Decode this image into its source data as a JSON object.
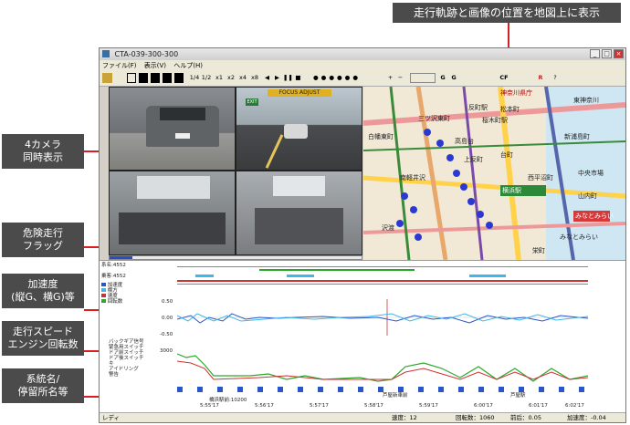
{
  "callouts": {
    "map": "走行軌跡と画像の位置を地図上に表示",
    "camera": [
      "4カメラ",
      "同時表示"
    ],
    "danger": [
      "危険走行",
      "フラッグ"
    ],
    "accel": [
      "加速度",
      "(縦G、横G)等"
    ],
    "speed": [
      "走行スピード",
      "エンジン回転数"
    ],
    "route": [
      "系統名/",
      "停留所名等"
    ]
  },
  "window": {
    "title": "CTA-039-300-300",
    "menu": [
      "ファイル(F)",
      "表示(V)",
      "ヘルプ(H)"
    ],
    "toolbar_speed": [
      "1/4",
      "1/2",
      "x1",
      "x2",
      "x4",
      "x8"
    ],
    "toolbar_misc": [
      "+",
      "−",
      "G",
      "G",
      "CF",
      "R"
    ]
  },
  "camera": {
    "overlay": "FOCUS ADJUST",
    "exit_sign": "EXIT"
  },
  "map_labels": [
    "神奈川県庁",
    "三ツ沢東町",
    "桜木町駅",
    "東神奈川",
    "台町",
    "西平沼町",
    "南軽井沢",
    "高島台",
    "横浜駅",
    "みなとみらい",
    "みなとみらい",
    "上反町",
    "新浦島町",
    "沢渡",
    "中央市場",
    "山内町",
    "白幡東町",
    "松本町",
    "反町駅",
    "栄町"
  ],
  "panel": {
    "row1_label": "系名:4552",
    "row2_label": "乗客:4552",
    "legend1": [
      "加速度",
      "横方",
      "速度",
      "回転数"
    ],
    "legend2": [
      "バックギア信号",
      "緊急用スイッチ",
      "ドア前スイッチ",
      "ドア後スイッチ",
      "キ",
      "アイドリング",
      "警告"
    ],
    "y_top": [
      "0.50",
      "0.00",
      "-0.50"
    ],
    "y_bottom": [
      "3000"
    ],
    "stop_labels": [
      "橋浜駅前:10200",
      "芦屋新車前",
      "芦屋駅"
    ],
    "time_ticks": [
      "5:55'17",
      "5:56'17",
      "5:57'17",
      "5:58'17",
      "5:59'17",
      "6:00'17",
      "6:01'17",
      "6:02'17"
    ]
  },
  "status": {
    "ready": "レディ",
    "speed": "速度：12",
    "rpm": "回転数：1060",
    "brake": "前后：0.05",
    "accel": "加速度：-0.04"
  },
  "colors": {
    "callout_bg": "#4b4b4b",
    "callout_line": "#d82020",
    "graph_blue": "#2a56c8",
    "graph_cyan": "#3fb7e8",
    "graph_green": "#2da82d",
    "graph_red": "#d03030"
  }
}
